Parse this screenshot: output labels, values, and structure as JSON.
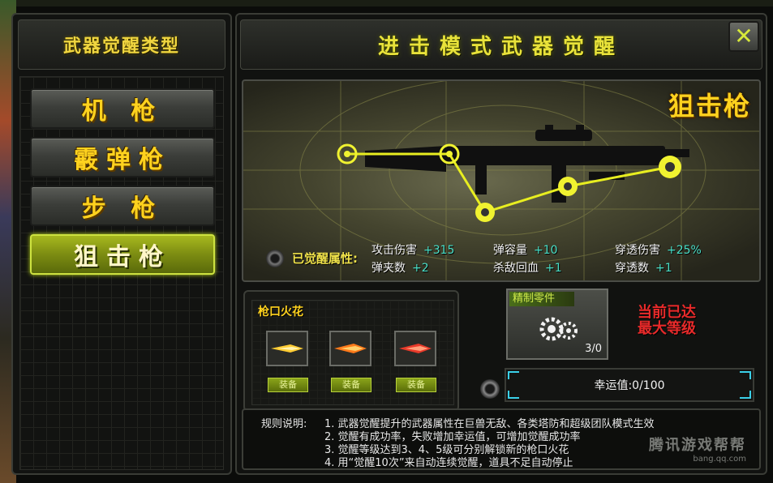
{
  "left_panel": {
    "title": "武器觉醒类型",
    "categories": [
      {
        "label": "机  枪",
        "active": false
      },
      {
        "label": "霰弹枪",
        "active": false
      },
      {
        "label": "步  枪",
        "active": false
      },
      {
        "label": "狙击枪",
        "active": true
      }
    ]
  },
  "main_panel": {
    "title": "进击模式武器觉醒",
    "close_icon": "✕",
    "weapon_type": "狙击枪",
    "awakened_label": "已觉醒属性:",
    "attributes": [
      {
        "name": "攻击伤害",
        "value": "+315"
      },
      {
        "name": "弹容量",
        "value": "+10"
      },
      {
        "name": "穿透伤害",
        "value": "+25%"
      },
      {
        "name": "弹夹数",
        "value": "+2"
      },
      {
        "name": "杀敌回血",
        "value": "+1"
      },
      {
        "name": "穿透数",
        "value": "+1"
      }
    ],
    "muzzle_flash": {
      "title": "枪口火花",
      "slots": [
        {
          "equip_label": "装备"
        },
        {
          "equip_label": "装备"
        },
        {
          "equip_label": "装备"
        }
      ]
    },
    "precision_part": {
      "title": "精制零件",
      "count": "3/0"
    },
    "max_level": [
      "当前已达",
      "最大等级"
    ],
    "luck": "幸运值:0/100",
    "rules": {
      "label": "规则说明:",
      "lines": [
        "1. 武器觉醒提升的武器属性在巨兽无敌、各类塔防和超级团队模式生效",
        "2. 觉醒有成功率，失败增加幸运值，可增加觉醒成功率",
        "3. 觉醒等级达到3、4、5级可分别解锁新的枪口火花",
        "4. 用“觉醒10次”来自动连续觉醒，道具不足自动停止"
      ]
    },
    "watermark": {
      "main": "腾讯游戏帮帮",
      "sub": "bang.qq.com"
    }
  },
  "colors": {
    "accent": "#ffd21e",
    "active_green": "#a7b81e",
    "stat_value": "#4ae0c8",
    "alert": "#e82a2a",
    "node_yellow": "#e8ee20"
  }
}
